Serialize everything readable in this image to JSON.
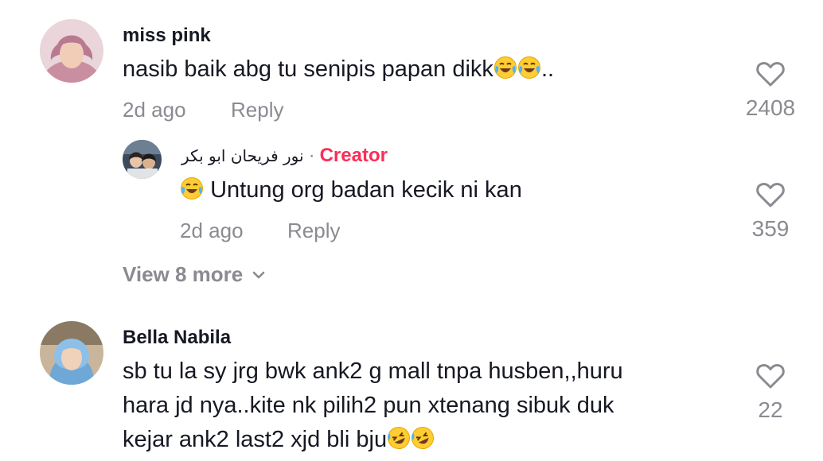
{
  "comments": [
    {
      "username": "miss pink",
      "text": "nasib baik abg tu senipis papan dikk",
      "text_suffix": "..",
      "emojis": [
        "face-with-tears-of-joy",
        "face-with-tears-of-joy"
      ],
      "time": "2d ago",
      "reply_label": "Reply",
      "likes": "2408",
      "replies": [
        {
          "username": "نور فريحان ابو بكر",
          "separator": "·",
          "badge": "Creator",
          "text": "Untung org badan kecik ni kan",
          "emojis": [
            "face-with-tears-of-joy"
          ],
          "time": "2d ago",
          "reply_label": "Reply",
          "likes": "359"
        }
      ],
      "view_more_label": "View 8 more"
    },
    {
      "username": "Bella Nabila",
      "text_line1": "sb tu la sy jrg bwk ank2 g mall tnpa husben,,huru",
      "text_line2": "hara jd nya..kite nk pilih2 pun xtenang sibuk duk",
      "text_line3": "kejar ank2 last2 xjd bli bju",
      "emojis": [
        "rolling-on-floor-laughing",
        "rolling-on-floor-laughing"
      ],
      "likes": "22"
    }
  ],
  "colors": {
    "text_primary": "#161823",
    "text_secondary": "#8a8b91",
    "creator_accent": "#fe2c55",
    "emoji_yellow": "#ffcc33"
  }
}
